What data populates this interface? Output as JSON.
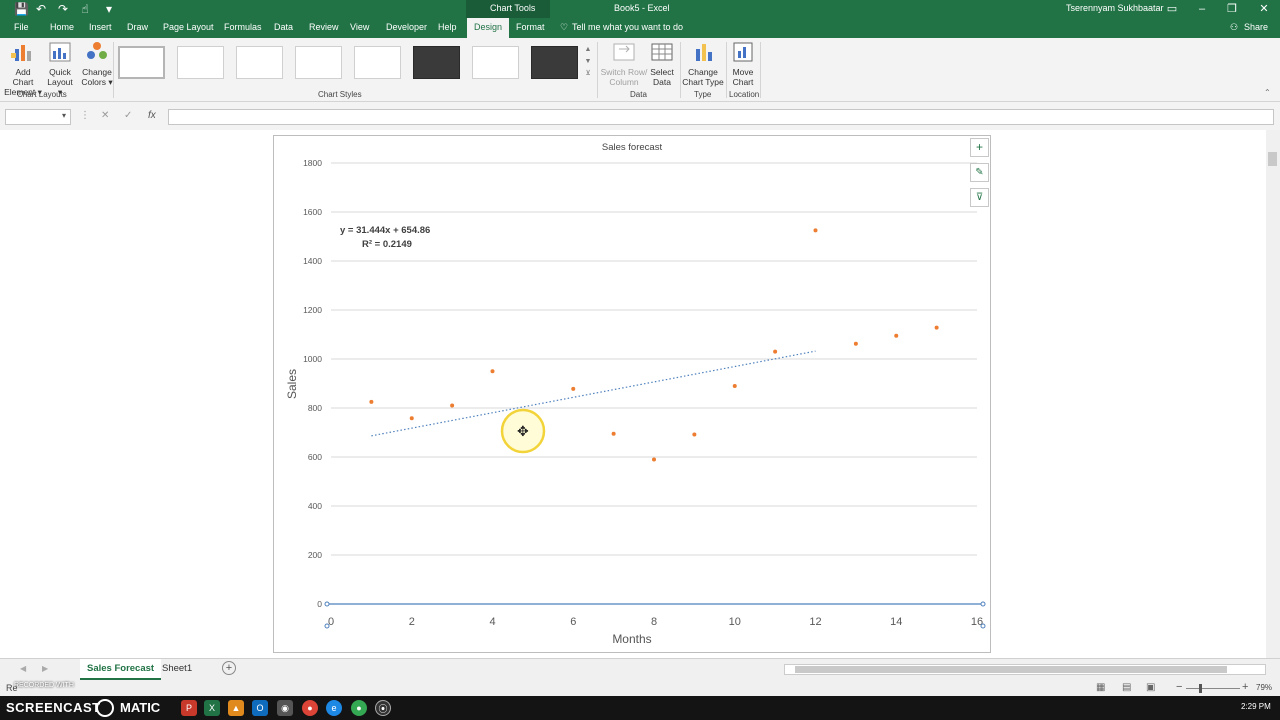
{
  "window": {
    "title": "Book5  -  Excel",
    "context_group": "Chart Tools",
    "user": "Tserennyam Sukhbaatar"
  },
  "quick_access": {
    "save": "💾",
    "undo": "↶",
    "redo": "↷",
    "touch": "☝",
    "customize": "▾"
  },
  "tabs": [
    "File",
    "Home",
    "Insert",
    "Draw",
    "Page Layout",
    "Formulas",
    "Data",
    "Review",
    "View",
    "Developer",
    "Help",
    "Design",
    "Format"
  ],
  "active_tab": "Design",
  "tell_me": "Tell me what you want to do",
  "share": "Share",
  "ribbon": {
    "add_chart_element": "Add Chart Element ▾",
    "quick_layout": "Quick Layout ▾",
    "change_colors": "Change Colors ▾",
    "switch_row_column": "Switch Row/ Column",
    "select_data": "Select Data",
    "change_chart_type": "Change Chart Type",
    "move_chart": "Move Chart",
    "groups": {
      "chart_layouts": "Chart Layouts",
      "chart_styles": "Chart Styles",
      "data": "Data",
      "type": "Type",
      "location": "Location"
    }
  },
  "formula_bar": {
    "fx": "fx",
    "cancel": "✕",
    "enter": "✓"
  },
  "chart_data": {
    "type": "scatter",
    "title": "Sales forecast",
    "xlabel": "Months",
    "ylabel": "Sales",
    "xlim": [
      0,
      16
    ],
    "ylim": [
      0,
      1800
    ],
    "x_ticks": [
      0,
      2,
      4,
      6,
      8,
      10,
      12,
      14,
      16
    ],
    "y_ticks": [
      0,
      200,
      400,
      600,
      800,
      1000,
      1200,
      1400,
      1600,
      1800
    ],
    "grid": true,
    "point_color": "#ed7d31",
    "trendline_color": "#4f81bd",
    "points": [
      {
        "x": 1,
        "y": 825
      },
      {
        "x": 2,
        "y": 758
      },
      {
        "x": 3,
        "y": 810
      },
      {
        "x": 4,
        "y": 950
      },
      {
        "x": 6,
        "y": 878
      },
      {
        "x": 7,
        "y": 695
      },
      {
        "x": 8,
        "y": 590
      },
      {
        "x": 9,
        "y": 692
      },
      {
        "x": 10,
        "y": 890
      },
      {
        "x": 11,
        "y": 1030
      },
      {
        "x": 12,
        "y": 1525
      },
      {
        "x": 13,
        "y": 1062
      },
      {
        "x": 14,
        "y": 1095
      },
      {
        "x": 15,
        "y": 1128
      }
    ],
    "trendline": {
      "slope": 31.444,
      "intercept": 654.86,
      "x_range": [
        1,
        12
      ]
    },
    "equation_label": "y = 31.444x + 654.86",
    "r2_label": "R² = 0.2149"
  },
  "chart_buttons": {
    "elements": "+",
    "styles": "✎",
    "filters": "⊽"
  },
  "sheet_tabs": [
    "Sales Forecast",
    "Sheet1"
  ],
  "active_sheet": "Sales Forecast",
  "add_sheet": "+",
  "status": {
    "left": "Re",
    "zoom": "79%",
    "zoom_minus": "−",
    "zoom_plus": "+"
  },
  "watermark": {
    "top": "RECORDED WITH",
    "bottom": "SCREENCAST",
    "suffix": "MATIC"
  },
  "taskbar": {
    "time": "2:29 PM"
  },
  "colors": {
    "excel_green": "#217346",
    "accent_orange": "#ed7d31",
    "trend_blue": "#4f81bd"
  }
}
